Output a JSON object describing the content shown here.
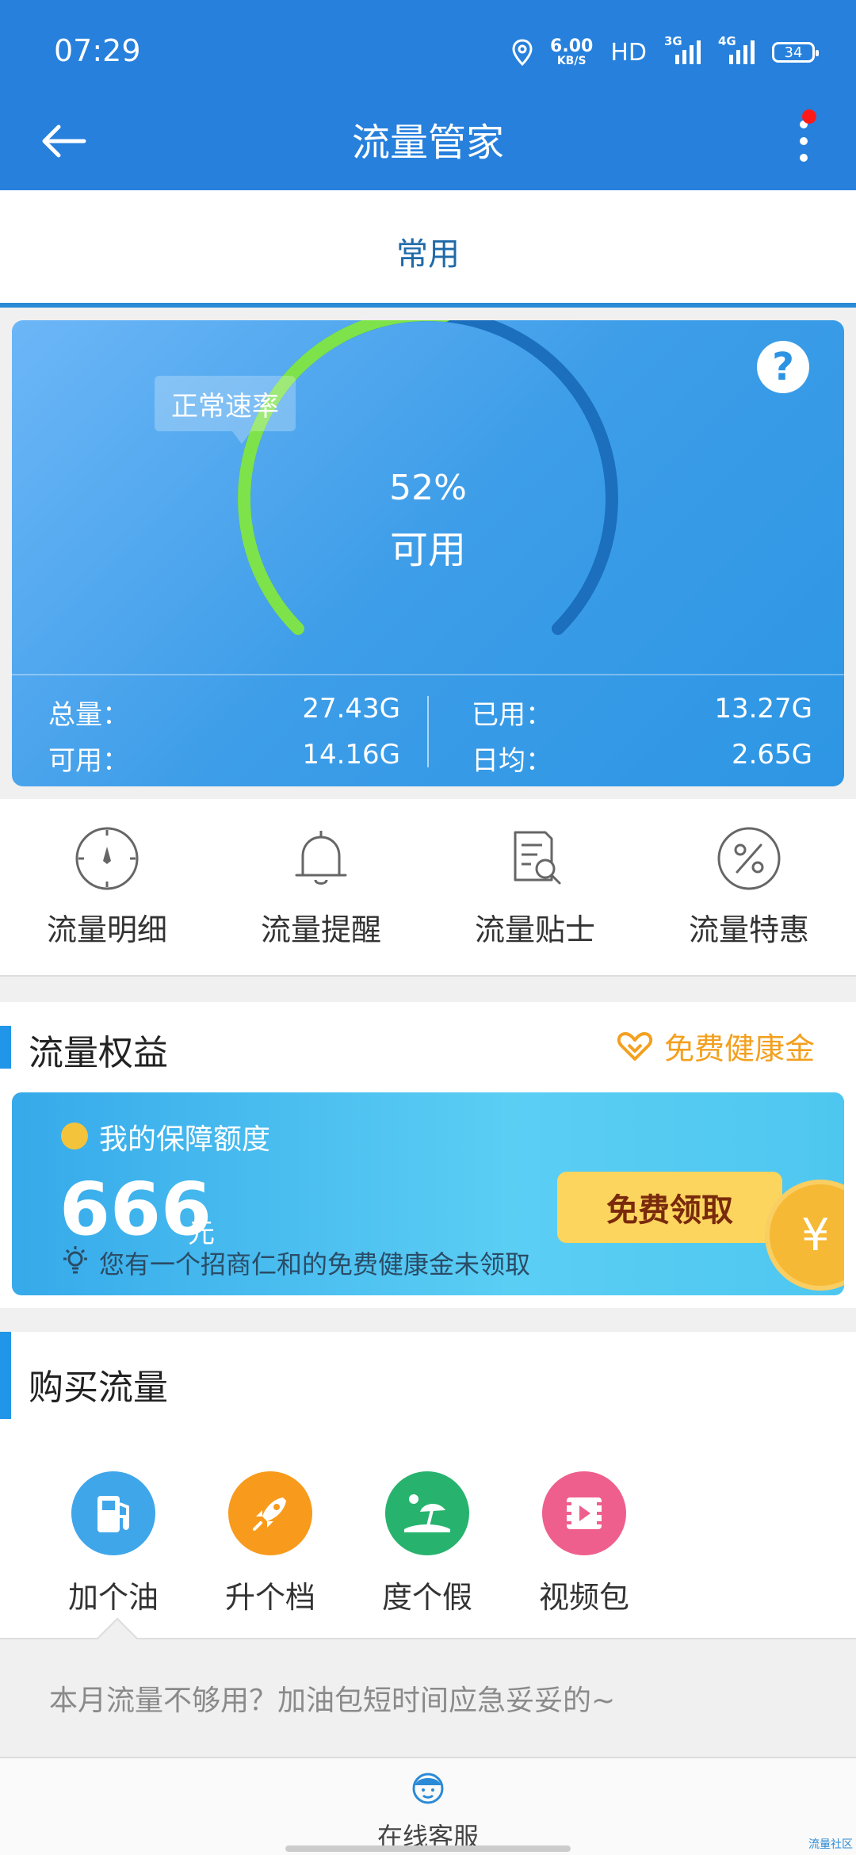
{
  "status_bar": {
    "time": "07:29",
    "speed_value": "6.00",
    "speed_unit": "KB/S",
    "hd": "HD",
    "net1": "3G",
    "net2": "4G",
    "battery": "34"
  },
  "title_bar": {
    "title": "流量管家"
  },
  "tabs": [
    {
      "label": "常用",
      "active": true
    }
  ],
  "gauge": {
    "speed_tag": "正常速率",
    "percent_text": "52%",
    "percent_available": 0.52,
    "available_label": "可用",
    "arc_color_used": "#1b6fbd",
    "arc_color_remaining": "#7ee24b"
  },
  "stats": {
    "total_label": "总量：",
    "total_value": "27.43G",
    "available_label": "可用：",
    "available_value": "14.16G",
    "used_label": "已用：",
    "used_value": "13.27G",
    "daily_label": "日均：",
    "daily_value": "2.65G"
  },
  "quick_menu": [
    {
      "label": "流量明细",
      "icon": "dial-icon"
    },
    {
      "label": "流量提醒",
      "icon": "bell-icon"
    },
    {
      "label": "流量贴士",
      "icon": "document-search-icon"
    },
    {
      "label": "流量特惠",
      "icon": "percent-icon"
    }
  ],
  "rights": {
    "title": "流量权益",
    "free_link": "免费健康金",
    "promo_title": "我的保障额度",
    "amount": "666",
    "unit": "元",
    "note": "您有一个招商仁和的免费健康金未领取",
    "claim_button": "免费领取",
    "coin_symbol": "¥"
  },
  "buy": {
    "title": "购买流量",
    "items": [
      {
        "label": "加个油",
        "icon": "fuel-pump-icon",
        "color": "#3fa6ea"
      },
      {
        "label": "升个档",
        "icon": "rocket-icon",
        "color": "#f89a1c"
      },
      {
        "label": "度个假",
        "icon": "beach-umbrella-icon",
        "color": "#27b36e"
      },
      {
        "label": "视频包",
        "icon": "film-icon",
        "color": "#ee5f8d"
      }
    ],
    "tip": "本月流量不够用？加油包短时间应急妥妥的~"
  },
  "bottom": {
    "customer_service": "在线客服",
    "watermark": "流量社区"
  }
}
